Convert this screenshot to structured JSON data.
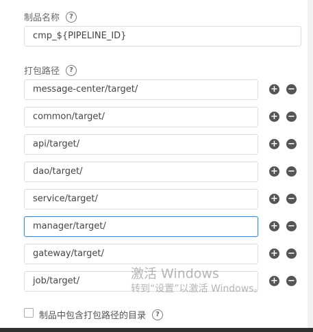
{
  "product_name": {
    "label": "制品名称",
    "help_icon": "question-circle-icon",
    "value": "cmp_${PIPELINE_ID}"
  },
  "package_paths": {
    "label": "打包路径",
    "help_icon": "question-circle-icon",
    "items": [
      "message-center/target/",
      "common/target/",
      "api/target/",
      "dao/target/",
      "service/target/",
      "manager/target/",
      "gateway/target/",
      "job/target/"
    ],
    "add_icon": "plus-circle-icon",
    "remove_icon": "minus-circle-icon",
    "focused_index": 5
  },
  "include_dir": {
    "label": "制品中包含打包路径的目录",
    "checked": false
  },
  "watermark": {
    "line1": "激活 Windows",
    "line2": "转到“设置”以激活 Windows。"
  },
  "colors": {
    "focus_border": "#3a8bd2",
    "icon_fill": "#555555",
    "input_border": "#dcdcdc"
  }
}
